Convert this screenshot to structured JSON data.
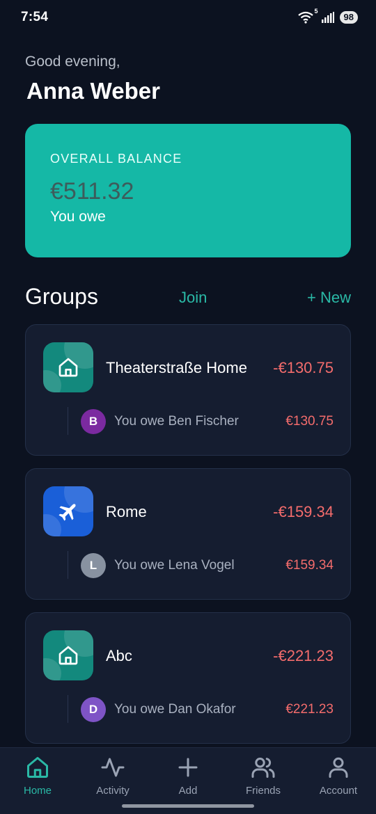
{
  "status_bar": {
    "time": "7:54",
    "network": "5",
    "battery": "98"
  },
  "header": {
    "greeting": "Good evening,",
    "user_name": "Anna Weber"
  },
  "balance": {
    "label": "OVERALL BALANCE",
    "amount": "€511.32",
    "status": "You owe"
  },
  "groups_section": {
    "title": "Groups",
    "join_label": "Join",
    "new_label": "+ New"
  },
  "groups": [
    {
      "name": "Theaterstraße Home",
      "total": "-€130.75",
      "icon": "house-icon",
      "icon_color": "#13897d",
      "debt": {
        "avatar_letter": "B",
        "avatar_color": "#7b2aa0",
        "text": "You owe Ben Fischer",
        "amount": "€130.75"
      }
    },
    {
      "name": "Rome",
      "total": "-€159.34",
      "icon": "airplane-icon",
      "icon_color": "#1a5fd8",
      "debt": {
        "avatar_letter": "L",
        "avatar_color": "#8892a1",
        "text": "You owe Lena Vogel",
        "amount": "€159.34"
      }
    },
    {
      "name": "Abc",
      "total": "-€221.23",
      "icon": "house-icon",
      "icon_color": "#13897d",
      "debt": {
        "avatar_letter": "D",
        "avatar_color": "#7e54c6",
        "text": "You owe Dan Okafor",
        "amount": "€221.23"
      }
    }
  ],
  "bottom_nav": {
    "active": "Home",
    "items": [
      {
        "label": "Home",
        "icon": "home-icon"
      },
      {
        "label": "Activity",
        "icon": "activity-icon"
      },
      {
        "label": "Add",
        "icon": "plus-icon"
      },
      {
        "label": "Friends",
        "icon": "friends-icon"
      },
      {
        "label": "Account",
        "icon": "account-icon"
      }
    ]
  },
  "colors": {
    "background": "#0c1220",
    "card": "#151d30",
    "accent": "#2ab9a6",
    "balance_card": "#15b8a6",
    "negative": "#f46c6c"
  }
}
